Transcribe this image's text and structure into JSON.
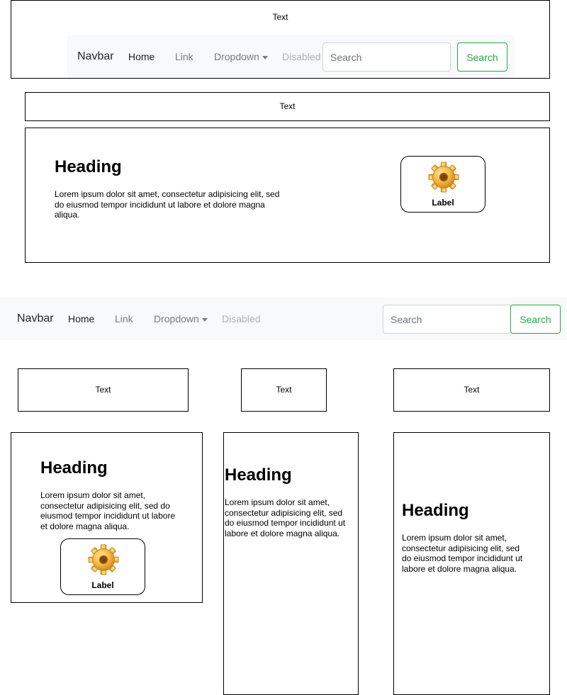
{
  "section1": {
    "text_label": "Text",
    "navbar": {
      "brand": "Navbar",
      "links": [
        "Home",
        "Link",
        "Dropdown",
        "Disabled"
      ],
      "search_placeholder": "Search",
      "search_button": "Search"
    }
  },
  "section2": {
    "text_label": "Text"
  },
  "hero": {
    "heading": "Heading",
    "body": "Lorem ipsum dolor sit amet, consectetur adipisicing elit, sed do eiusmod tempor incididunt ut labore et dolore magna aliqua.",
    "icon": "gear-icon",
    "icon_label": "Label"
  },
  "navbar2": {
    "brand": "Navbar",
    "links": [
      "Home",
      "Link",
      "Dropdown",
      "Disabled"
    ],
    "search_placeholder": "Search",
    "search_button": "Search"
  },
  "text_boxes": [
    "Text",
    "Text",
    "Text"
  ],
  "cards": [
    {
      "heading": "Heading",
      "body": "Lorem ipsum dolor sit amet, consectetur adipisicing elit, sed do eiusmod tempor incididunt ut labore et dolore magna aliqua.",
      "icon": "gear-icon",
      "icon_label": "Label"
    },
    {
      "heading": "Heading",
      "body": "Lorem ipsum dolor sit amet, consectetur adipisicing elit, sed do eiusmod tempor incididunt ut labore et dolore magna aliqua."
    },
    {
      "heading": "Heading",
      "body": "Lorem ipsum dolor sit amet, consectetur adipisicing elit, sed do eiusmod tempor incididunt ut labore et dolore magna aliqua."
    }
  ],
  "colors": {
    "navbar_bg": "#f8f9fa",
    "success": "#28a745",
    "muted_link": "#7a7a7a",
    "disabled_link": "#b0b0b0"
  }
}
